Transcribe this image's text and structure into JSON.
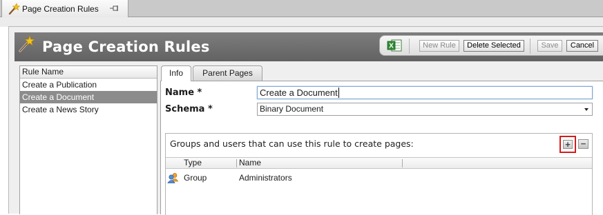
{
  "document_tab": {
    "label": "Page Creation Rules",
    "icon": "magic-wand-icon",
    "pin_icon": "pin-icon"
  },
  "header": {
    "title": "Page Creation Rules",
    "icon": "magic-wand-icon"
  },
  "toolbar": {
    "export_icon": "excel-icon",
    "new_rule_label": "New Rule",
    "delete_selected_label": "Delete Selected",
    "save_label": "Save",
    "cancel_label": "Cancel",
    "new_rule_enabled": false,
    "save_enabled": false
  },
  "rule_list": {
    "column_header": "Rule Name",
    "items": [
      {
        "label": "Create a Publication",
        "selected": false
      },
      {
        "label": "Create a Document",
        "selected": true
      },
      {
        "label": "Create a News Story",
        "selected": false
      }
    ]
  },
  "detail": {
    "tabs": [
      {
        "label": "Info",
        "active": true
      },
      {
        "label": "Parent Pages",
        "active": false
      }
    ],
    "name_label": "Name *",
    "name_value": "Create a Document",
    "schema_label": "Schema *",
    "schema_value": "Binary Document",
    "groups": {
      "title": "Groups and users that can use this rule to create pages:",
      "add_icon": "plus-icon",
      "remove_icon": "minus-icon",
      "highlight_color": "#d41b1b",
      "columns": [
        "Type",
        "Name"
      ],
      "rows": [
        {
          "icon": "group-icon",
          "type": "Group",
          "name": "Administrators"
        }
      ]
    }
  },
  "colors": {
    "header_bar": "#6f6f6f",
    "selected_row": "#8c8c8c",
    "input_focus_border": "#7fa6cf"
  }
}
